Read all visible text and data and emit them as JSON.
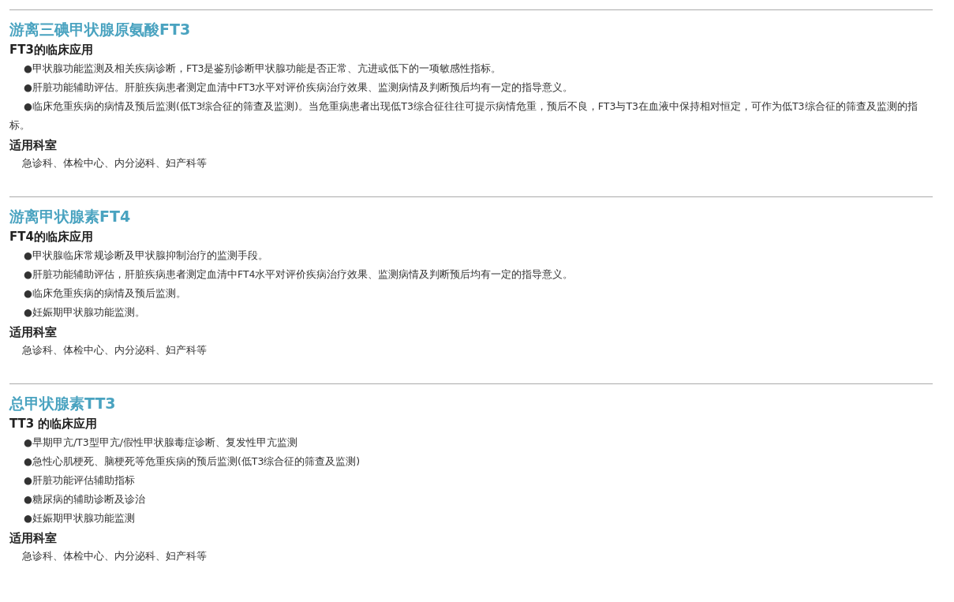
{
  "sections": [
    {
      "title": "游离三碘甲状腺原氨酸FT3",
      "subtitle": "FT3的临床应用",
      "items": [
        "●甲状腺功能监测及相关疾病诊断，FT3是鉴别诊断甲状腺功能是否正常、亢进或低下的一项敏感性指标。",
        "●肝脏功能辅助评估。肝脏疾病患者测定血清中FT3水平对评价疾病治疗效果、监测病情及判断预后均有一定的指导意义。",
        "●临床危重疾病的病情及预后监测(低T3综合征的筛查及监测)。当危重病患者出现低T3综合征往往可提示病情危重，预后不良，FT3与T3在血液中保持相对恒定，可作为低T3综合征的筛查及监测的指标。"
      ],
      "dept_heading": "适用科室",
      "departments": "急诊科、体检中心、内分泌科、妇产科等"
    },
    {
      "title": "游离甲状腺素FT4",
      "subtitle": "FT4的临床应用",
      "items": [
        "●甲状腺临床常规诊断及甲状腺抑制治疗的监测手段。",
        "●肝脏功能辅助评估，肝脏疾病患者测定血清中FT4水平对评价疾病治疗效果、监测病情及判断预后均有一定的指导意义。",
        "●临床危重疾病的病情及预后监测。",
        "●妊娠期甲状腺功能监测。"
      ],
      "dept_heading": "适用科室",
      "departments": "急诊科、体检中心、内分泌科、妇产科等"
    },
    {
      "title": "总甲状腺素TT3",
      "subtitle": "TT3 的临床应用",
      "items": [
        "●早期甲亢/T3型甲亢/假性甲状腺毒症诊断、复发性甲亢监测",
        "●急性心肌梗死、脑梗死等危重疾病的预后监测(低T3综合征的筛查及监测)",
        "●肝脏功能评估辅助指标",
        "●糖尿病的辅助诊断及诊治",
        "●妊娠期甲状腺功能监测"
      ],
      "dept_heading": "适用科室",
      "departments": "急诊科、体检中心、内分泌科、妇产科等"
    }
  ]
}
